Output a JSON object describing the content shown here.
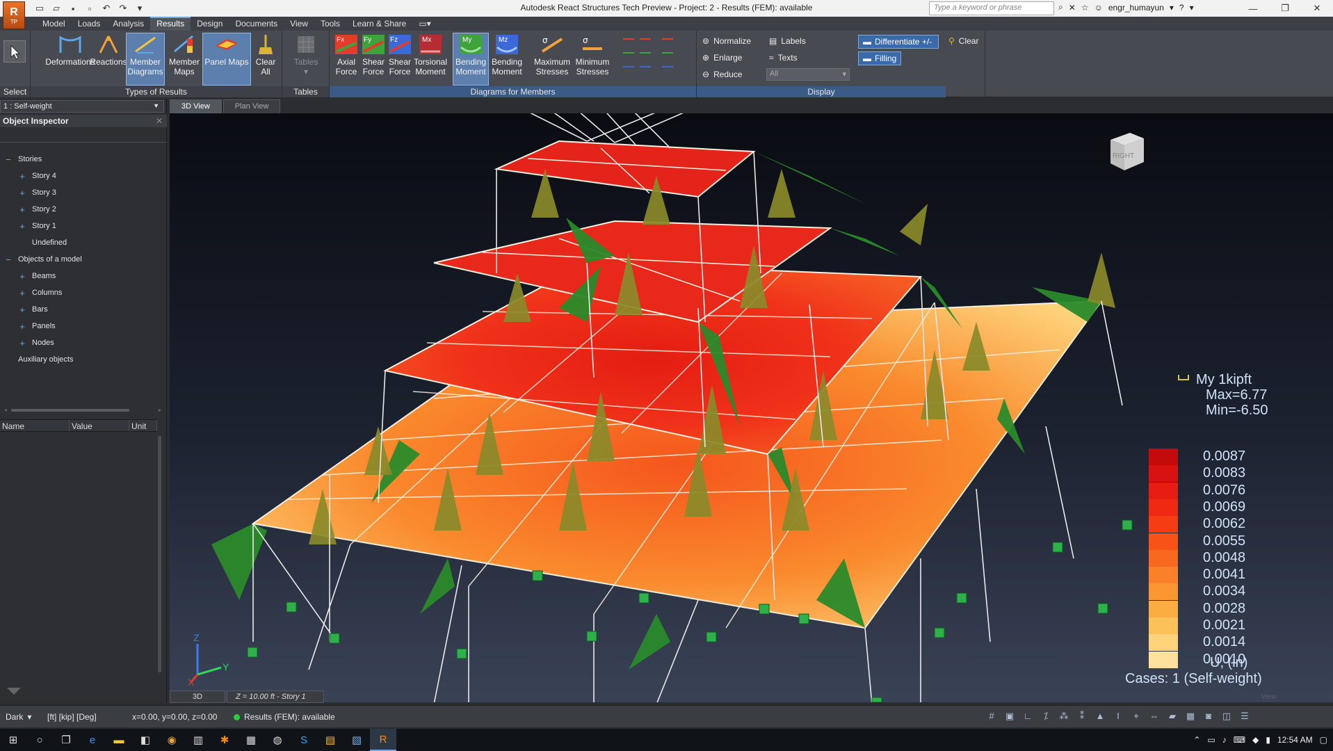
{
  "window": {
    "title": "Autodesk React Structures Tech Preview - Project: 2 - Results (FEM): available",
    "search_placeholder": "Type a keyword or phrase",
    "user": "engr_humayun",
    "logo_text": "R",
    "logo_sub": "TP"
  },
  "tabs": [
    "Model",
    "Loads",
    "Analysis",
    "Results",
    "Design",
    "Documents",
    "View",
    "Tools",
    "Learn & Share"
  ],
  "active_tab": "Results",
  "ribbon": {
    "select_label": "Select",
    "types_group": "Types of Results",
    "types_buttons": [
      {
        "label1": "Deformations",
        "label2": ""
      },
      {
        "label1": "Reactions",
        "label2": ""
      },
      {
        "label1": "Member",
        "label2": "Diagrams"
      },
      {
        "label1": "Member",
        "label2": "Maps"
      },
      {
        "label1": "Panel Maps",
        "label2": ""
      },
      {
        "label1": "Clear All",
        "label2": ""
      }
    ],
    "tables_group": "Tables",
    "tables_button": "Tables",
    "members_group": "Diagrams for Members",
    "members_buttons": [
      {
        "label1": "Axial",
        "label2": "Force"
      },
      {
        "label1": "Shear",
        "label2": "Force"
      },
      {
        "label1": "Shear",
        "label2": "Force"
      },
      {
        "label1": "Torsional",
        "label2": "Moment"
      },
      {
        "label1": "Bending",
        "label2": "Moment"
      },
      {
        "label1": "Bending",
        "label2": "Moment"
      },
      {
        "label1": "Maximum",
        "label2": "Stresses"
      },
      {
        "label1": "Minimum",
        "label2": "Stresses"
      }
    ],
    "display_group": "Display",
    "normalize": "Normalize",
    "enlarge": "Enlarge",
    "reduce": "Reduce",
    "labels": "Labels",
    "texts": "Texts",
    "all_select": "All",
    "differentiate": "Differentiate +/-",
    "filling": "Filling",
    "clear": "Clear"
  },
  "left_panel": {
    "case": "1 : Self-weight",
    "inspector_title": "Object Inspector",
    "tree": [
      {
        "label": "Stories",
        "level": 0,
        "toggle": "−"
      },
      {
        "label": "Story 4",
        "level": 1,
        "toggle": "+"
      },
      {
        "label": "Story 3",
        "level": 1,
        "toggle": "+"
      },
      {
        "label": "Story 2",
        "level": 1,
        "toggle": "+"
      },
      {
        "label": "Story 1",
        "level": 1,
        "toggle": "+"
      },
      {
        "label": "Undefined",
        "level": 1,
        "toggle": ""
      },
      {
        "label": "Objects of a model",
        "level": 0,
        "toggle": "−"
      },
      {
        "label": "Beams",
        "level": 1,
        "toggle": "+"
      },
      {
        "label": "Columns",
        "level": 1,
        "toggle": "+"
      },
      {
        "label": "Bars",
        "level": 1,
        "toggle": "+"
      },
      {
        "label": "Panels",
        "level": 1,
        "toggle": "+"
      },
      {
        "label": "Nodes",
        "level": 1,
        "toggle": "+"
      },
      {
        "label": "Auxiliary objects",
        "level": 0,
        "toggle": ""
      }
    ],
    "props_columns": [
      "Name",
      "Value",
      "Unit"
    ]
  },
  "viewport": {
    "tabs": [
      "3D View",
      "Plan View"
    ],
    "active": "3D View",
    "view_cube": "RIGHT",
    "legend_my": "My  1kipft",
    "legend_max": "Max=6.77",
    "legend_min": "Min=-6.50",
    "scale_values": [
      "0.0087",
      "0.0083",
      "0.0076",
      "0.0069",
      "0.0062",
      "0.0055",
      "0.0048",
      "0.0041",
      "0.0034",
      "0.0028",
      "0.0021",
      "0.0014",
      "0.0010"
    ],
    "scale_colors": [
      "#c50a0a",
      "#d81210",
      "#e81d12",
      "#f02a12",
      "#f53c12",
      "#f75218",
      "#f8681f",
      "#fa8029",
      "#fb9733",
      "#fcad42",
      "#fdc15a",
      "#fed27a",
      "#ffe19d"
    ],
    "unit": "U, (in)",
    "cases": "Cases: 1 (Self-weight)",
    "watermark": "View",
    "status_3d": "3D",
    "status_z": "Z = 10.00 ft - Story 1",
    "axis_x": "X",
    "axis_y": "Y",
    "axis_z": "Z"
  },
  "statusbar": {
    "theme": "Dark",
    "units": "[ft] [kip] [Deg]",
    "coords": "x=0.00, y=0.00, z=0.00",
    "results": "Results (FEM): available"
  },
  "taskbar": {
    "time": "12:54 AM"
  }
}
